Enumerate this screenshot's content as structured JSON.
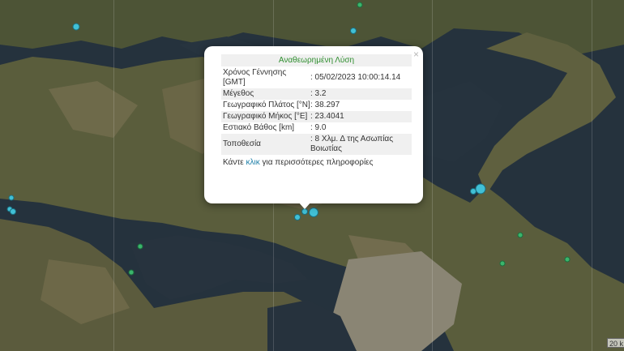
{
  "popup": {
    "title": "Αναθεωρημένη Λύση",
    "close_glyph": "×",
    "rows": [
      {
        "label": "Χρόνος Γέννησης [GMT]",
        "value": ": 05/02/2023 10:00:14.14"
      },
      {
        "label": "Μέγεθος",
        "value": ": 3.2"
      },
      {
        "label": "Γεωγραφικό Πλάτος [°N]",
        "value": ": 38.297"
      },
      {
        "label": "Γεωγραφικό Μήκος [°E]",
        "value": ": 23.4041"
      },
      {
        "label": "Εστιακό Βάθος [km]",
        "value": ": 9.0"
      },
      {
        "label": "Τοποθεσία",
        "value": ": 8 Χλμ. Δ της Ασωπίας Βοιωτίας"
      }
    ],
    "footer_pre": "Κάντε ",
    "footer_link": "κλικ",
    "footer_post": " για περισσότερες πληροφορίες"
  },
  "scale": {
    "label": "20 k"
  },
  "colors": {
    "recent_marker": "#41c0d6",
    "older_marker": "#3bb56c",
    "title_text": "#2f8e2f",
    "link": "#1d7fa8"
  }
}
